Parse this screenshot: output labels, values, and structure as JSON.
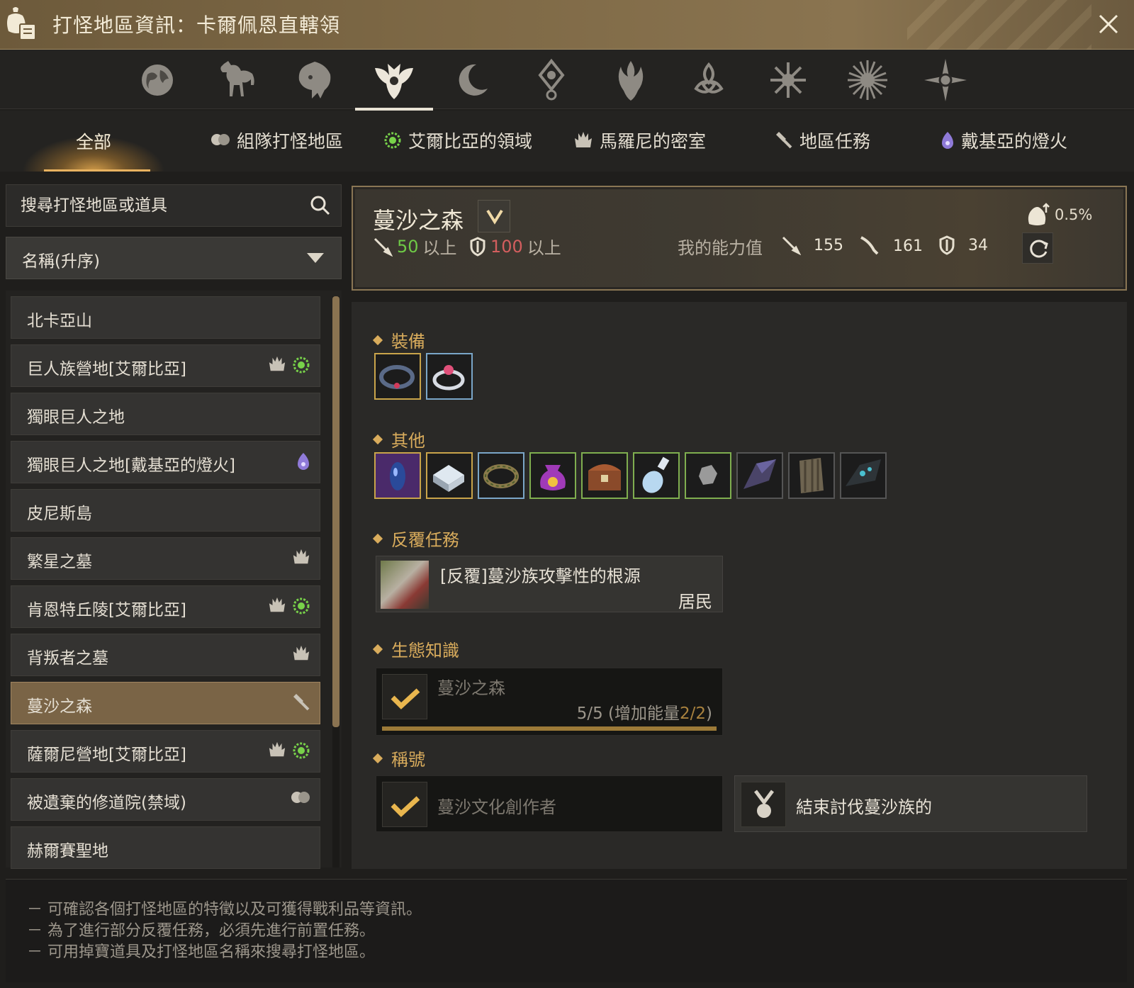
{
  "window": {
    "title": "打怪地區資訊：卡爾佩恩直轄領"
  },
  "region_tabs": [
    {
      "icon": "globe-icon"
    },
    {
      "icon": "horse-icon"
    },
    {
      "icon": "lion-icon"
    },
    {
      "icon": "winged-crest-icon",
      "active": true
    },
    {
      "icon": "crescent-moon-icon"
    },
    {
      "icon": "eye-emblem-icon"
    },
    {
      "icon": "flame-crest-icon"
    },
    {
      "icon": "triquetra-icon"
    },
    {
      "icon": "star-burst-icon"
    },
    {
      "icon": "sun-icon"
    },
    {
      "icon": "compass-star-icon"
    }
  ],
  "categories": {
    "all": "全部",
    "party": "組隊打怪地區",
    "elvia": "艾爾比亞的領域",
    "marni": "馬羅尼的密室",
    "quest": "地區任務",
    "atoraxxion": "戴基亞的燈火"
  },
  "search": {
    "placeholder": "搜尋打怪地區或道具"
  },
  "sort": {
    "label": "名稱(升序)"
  },
  "zones": [
    {
      "name": "北卡亞山",
      "icons": []
    },
    {
      "name": "巨人族營地[艾爾比亞]",
      "icons": [
        "marni",
        "elvia"
      ]
    },
    {
      "name": "獨眼巨人之地",
      "icons": []
    },
    {
      "name": "獨眼巨人之地[戴基亞的燈火]",
      "icons": [
        "atoraxxion"
      ]
    },
    {
      "name": "皮尼斯島",
      "icons": []
    },
    {
      "name": "繁星之墓",
      "icons": [
        "marni"
      ]
    },
    {
      "name": "肯恩特丘陵[艾爾比亞]",
      "icons": [
        "marni",
        "elvia"
      ]
    },
    {
      "name": "背叛者之墓",
      "icons": [
        "marni"
      ]
    },
    {
      "name": "蔓沙之森",
      "icons": [
        "quest"
      ],
      "selected": true
    },
    {
      "name": "薩爾尼營地[艾爾比亞]",
      "icons": [
        "marni",
        "elvia"
      ]
    },
    {
      "name": "被遺棄的修道院(禁域)",
      "icons": [
        "party"
      ]
    },
    {
      "name": "赫爾賽聖地",
      "icons": []
    }
  ],
  "zone": {
    "name": "蔓沙之森",
    "req_ap": "50",
    "req_ap_suffix": "以上",
    "req_dp": "100",
    "req_dp_suffix": "以上",
    "my_stats_label": "我的能力值",
    "my_ap": "155",
    "my_aap": "161",
    "my_dp": "34",
    "drop_rate": "0.5%"
  },
  "sections": {
    "equipment": "裝備",
    "other": "其他",
    "repeat_quest": "反覆任務",
    "knowledge": "生態知識",
    "titles": "稱號"
  },
  "equipment_items": [
    {
      "icon": "dark-bracelet-icon",
      "grade": "#c9a44a"
    },
    {
      "icon": "ruby-ring-icon",
      "grade": "#7aa6c8"
    }
  ],
  "other_items": [
    {
      "icon": "dark-crystal-icon",
      "grade": "#c9a44a"
    },
    {
      "icon": "white-crystal-box-icon",
      "grade": "#c9a44a"
    },
    {
      "icon": "leaf-bracelet-icon",
      "grade": "#7aa6c8"
    },
    {
      "icon": "purple-pouch-icon",
      "grade": "#7fae4f"
    },
    {
      "icon": "treasure-chest-icon",
      "grade": "#7fae4f"
    },
    {
      "icon": "potion-vial-icon",
      "grade": "#7fae4f"
    },
    {
      "icon": "stone-fragment-icon",
      "grade": "#7fae4f"
    },
    {
      "icon": "dark-shard-icon",
      "grade": "#555555"
    },
    {
      "icon": "bark-scrap-icon",
      "grade": "#555555"
    },
    {
      "icon": "teal-ore-icon",
      "grade": "#555555"
    }
  ],
  "quest": {
    "name": "[反覆]蔓沙族攻擊性的根源",
    "giver": "居民"
  },
  "knowledge": {
    "name": "蔓沙之森",
    "progress": "5/5",
    "energy_label": "(增加能量",
    "energy_value": "2/2",
    "energy_close": ")",
    "fill": 1.0
  },
  "titles": [
    {
      "name": "蔓沙文化創作者",
      "obtained": true
    },
    {
      "name": "結束討伐蔓沙族的",
      "obtained": false
    }
  ],
  "footer": [
    "－ 可確認各個打怪地區的特徵以及可獲得戰利品等資訊。",
    "－ 為了進行部分反覆任務，必須先進行前置任務。",
    "－ 可用掉寶道具及打怪地區名稱來搜尋打怪地區。"
  ],
  "colors": {
    "accent": "#d9ac5c",
    "green": "#6ec946",
    "red": "#d35e5e",
    "selected": "#7a6446"
  }
}
